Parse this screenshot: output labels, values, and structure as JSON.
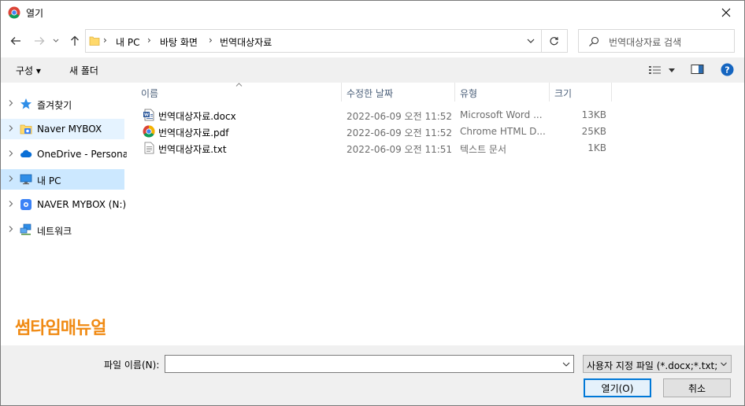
{
  "window": {
    "title": "열기"
  },
  "address": {
    "crumbs": [
      "내 PC",
      "바탕 화면",
      "번역대상자료"
    ],
    "search_placeholder": "번역대상자료 검색"
  },
  "toolbar": {
    "organize": "구성 ▾",
    "new_folder": "새 폴더"
  },
  "navpane": {
    "items": [
      {
        "label": "즐겨찾기",
        "icon": "star-icon"
      },
      {
        "label": "Naver MYBOX",
        "icon": "mybox-icon"
      },
      {
        "label": "OneDrive - Personal",
        "icon": "cloud-icon"
      },
      {
        "label": "내 PC",
        "icon": "pc-icon"
      },
      {
        "label": "NAVER MYBOX (N:)",
        "icon": "drive-icon"
      },
      {
        "label": "네트워크",
        "icon": "network-icon"
      }
    ]
  },
  "watermark": "썸타임매뉴얼",
  "columns": {
    "name": "이름",
    "date": "수정한 날짜",
    "type": "유형",
    "size": "크기"
  },
  "files": [
    {
      "name": "번역대상자료.docx",
      "date": "2022-06-09 오전 11:52",
      "type": "Microsoft Word ...",
      "size": "13KB",
      "icon": "word-doc-icon"
    },
    {
      "name": "번역대상자료.pdf",
      "date": "2022-06-09 오전 11:52",
      "type": "Chrome HTML D...",
      "size": "25KB",
      "icon": "chrome-pdf-icon"
    },
    {
      "name": "번역대상자료.txt",
      "date": "2022-06-09 오전 11:51",
      "type": "텍스트 문서",
      "size": "1KB",
      "icon": "text-file-icon"
    }
  ],
  "bottom": {
    "filename_label": "파일 이름(N):",
    "filename_value": "",
    "filetype": "사용자 지정 파일 (*.docx;*.txt;*",
    "open_button": "열기(O)",
    "cancel_button": "취소"
  },
  "colors": {
    "selected_bg": "#cce8ff",
    "hover_bg": "#e5f3ff",
    "accent": "#0078d7",
    "watermark": "#f08a13"
  }
}
